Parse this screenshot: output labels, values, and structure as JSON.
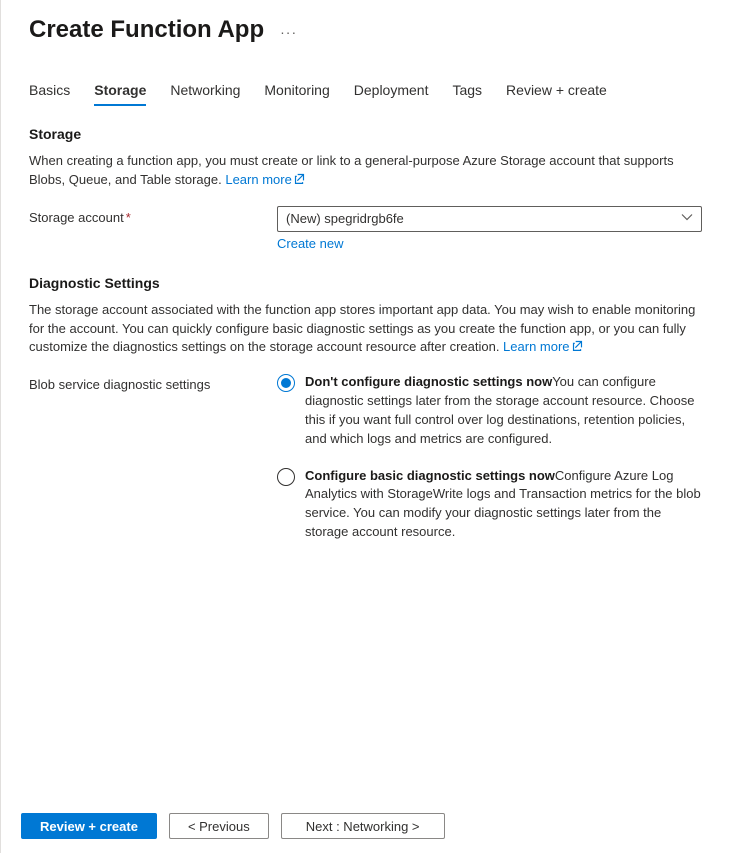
{
  "page_title": "Create Function App",
  "tabs": [
    "Basics",
    "Storage",
    "Networking",
    "Monitoring",
    "Deployment",
    "Tags",
    "Review + create"
  ],
  "active_tab": 1,
  "storage": {
    "heading": "Storage",
    "description": "When creating a function app, you must create or link to a general-purpose Azure Storage account that supports Blobs, Queue, and Table storage.  ",
    "learn_more": "Learn more",
    "account_label": "Storage account",
    "account_value": "(New) spegridrgb6fe",
    "create_new": "Create new"
  },
  "diagnostic": {
    "heading": "Diagnostic Settings",
    "description": "The storage account associated with the function app stores important app data. You may wish to enable monitoring for the account. You can quickly configure basic diagnostic settings as you create the function app, or you can fully customize the diagnostics settings on the storage account resource after creation. ",
    "learn_more": "Learn more",
    "field_label": "Blob service diagnostic settings",
    "options": [
      {
        "title": "Don't configure diagnostic settings now",
        "desc": "You can configure diagnostic settings later from the storage account resource. Choose this if you want full control over log destinations, retention policies, and which logs and metrics are configured.",
        "checked": true
      },
      {
        "title": "Configure basic diagnostic settings now",
        "desc": "Configure Azure Log Analytics with StorageWrite logs and Transaction metrics for the blob service. You can modify your diagnostic settings later from the storage account resource.",
        "checked": false
      }
    ]
  },
  "footer": {
    "review": "Review + create",
    "previous": "<  Previous",
    "next": "Next : Networking  >"
  }
}
